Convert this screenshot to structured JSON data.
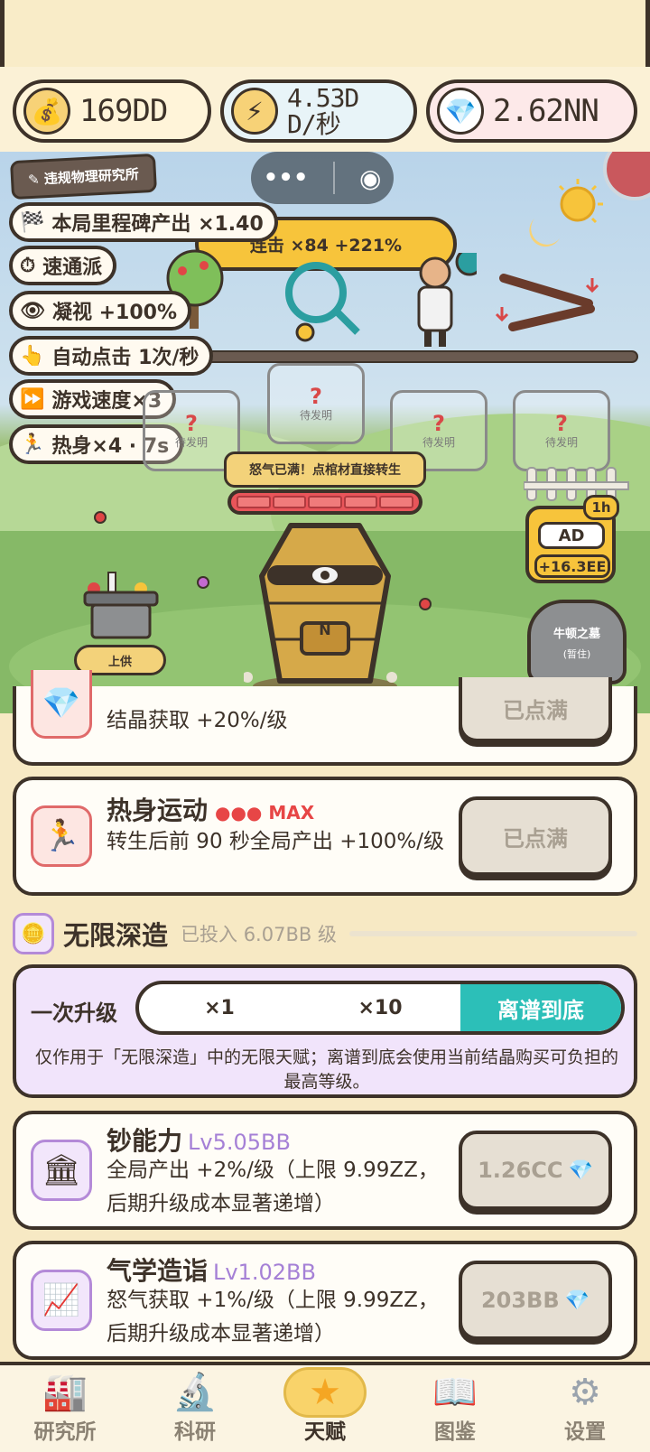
{
  "resources": {
    "money": "169DD",
    "energy": "4.53D\nD/秒",
    "energy_line1": "4.53D",
    "energy_line2": "D/秒",
    "gems": "2.62NN"
  },
  "scene": {
    "lab_tag": "违规物理研究所",
    "combo": "连击 ×84 +221%",
    "buffs": [
      {
        "icon": "checkered-flag-icon",
        "label": "本局里程碑产出 ×1.40"
      },
      {
        "icon": "stopwatch-icon",
        "label": "速通派"
      },
      {
        "icon": "eye-icon",
        "label": "凝视 +100%"
      },
      {
        "icon": "pointing-hand-icon",
        "label": "自动点击 1次/秒"
      },
      {
        "icon": "fast-forward-icon",
        "label": "游戏速度×3"
      },
      {
        "icon": "runner-icon",
        "label": "热身×4 · 7s"
      }
    ],
    "slots": [
      "待发明",
      "待发明",
      "待发明",
      "待发明",
      "待发明"
    ],
    "slot_mark": "?",
    "anger_text": "怒气已满！点棺材直接转生",
    "anger_level": 1.0,
    "altar_button": "上供",
    "coffin_letter": "N",
    "ad": {
      "label": "AD",
      "reward": "+16.3EE",
      "badge": "1h"
    },
    "tomb": {
      "title": "牛顿之墓",
      "subtitle": "(暂住)"
    }
  },
  "talents": [
    {
      "desc": "结晶获取 +20%/级",
      "button": "已点满"
    },
    {
      "title": "热身运动",
      "max_dots": "●●●",
      "max_label": "MAX",
      "desc": "转生后前 90 秒全局产出 +100%/级",
      "button": "已点满"
    }
  ],
  "infinite": {
    "title": "无限深造",
    "invested": "已投入 6.07BB 级",
    "upgrade_label": "一次升级",
    "options": [
      "×1",
      "×10",
      "离谱到底"
    ],
    "selected": "离谱到底",
    "note": "仅作用于「无限深造」中的无限天赋；离谱到底会使用当前结晶购买可负担的最高等级。",
    "items": [
      {
        "title": "钞能力",
        "level": "Lv5.05BB",
        "desc": "全局产出 +2%/级（上限 9.99ZZ，后期升级成本显著递增）",
        "cost": "1.26CC"
      },
      {
        "title": "气学造诣",
        "level": "Lv1.02BB",
        "desc": "怒气获取 +1%/级（上限 9.99ZZ，后期升级成本显著递增）",
        "cost": "203BB"
      }
    ]
  },
  "nav": [
    {
      "label": "研究所",
      "icon": "factory-icon"
    },
    {
      "label": "科研",
      "icon": "microscope-icon"
    },
    {
      "label": "天赋",
      "icon": "star-icon"
    },
    {
      "label": "图鉴",
      "icon": "book-icon"
    },
    {
      "label": "设置",
      "icon": "gear-icon"
    }
  ],
  "nav_active": "天赋",
  "colors": {
    "accent": "#2cbfb8",
    "gold": "#f7c43b",
    "outline": "#3d3229",
    "level": "#a580d6",
    "max": "#e74646"
  }
}
